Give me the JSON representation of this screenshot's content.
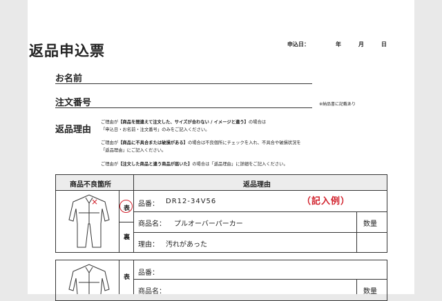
{
  "form": {
    "title": "返品申込票",
    "date_label": "申込日：",
    "year": "年",
    "month": "月",
    "day": "日",
    "name_label": "お名前",
    "order_label": "注文番号",
    "order_note": "※納品書に記載あり",
    "reason_label": "返品理由"
  },
  "instructions": {
    "p1_lead": "ご理由が",
    "p1_bold": "【商品を間違えて注文した、サイズが合わない / イメージと違う】",
    "p1_tail": "の場合は",
    "p1_line2": "「申込日・お名前・注文番号」のみをご記入ください。",
    "p2_lead": "ご理由が",
    "p2_bold": "【商品に不具合または破損がある】",
    "p2_tail": "の場合は不良個所にチェックを入れ、不具合や破損状況を",
    "p2_line2": "「返品理由」にご記入ください。",
    "p3_lead": "ご理由が",
    "p3_bold": "【注文した商品と違う商品が届いた】",
    "p3_tail": "の場合は「返品理由」に詳細をご記入ください。"
  },
  "table": {
    "header_defect": "商品不良箇所",
    "header_reason": "返品理由",
    "front": "表",
    "back": "裏",
    "example_label": "（記入例）",
    "defect_mark": "×",
    "row1": {
      "item_no_label": "品番：",
      "item_no_value": "DR12-34V56",
      "item_name_label": "商品名：",
      "item_name_value": "プルオーバーパーカー",
      "reason_label": "理由：",
      "reason_value": "汚れがあった",
      "qty_label": "数量"
    },
    "row2": {
      "item_no_label": "品番：",
      "item_name_label": "商品名：",
      "qty_label": "数量",
      "front": "表"
    }
  }
}
